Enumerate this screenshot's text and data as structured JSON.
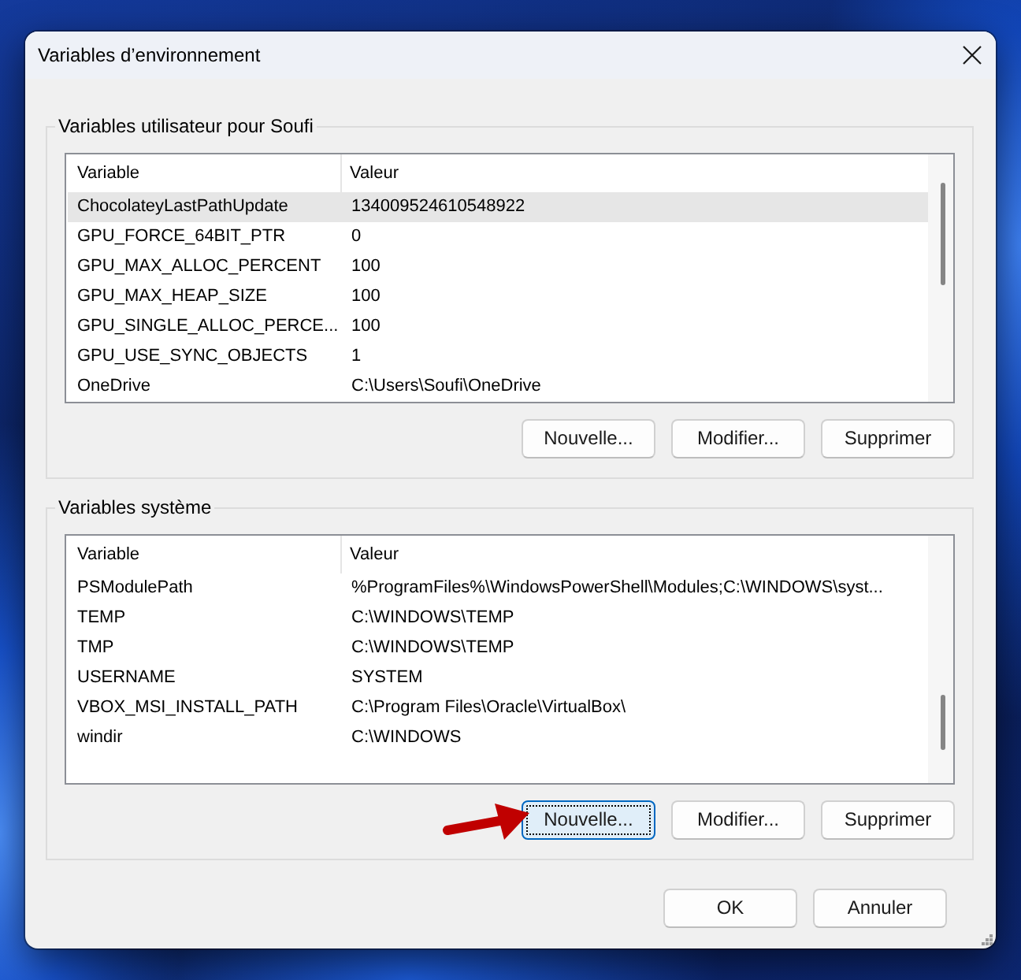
{
  "window": {
    "title": "Variables d’environnement"
  },
  "user_variables": {
    "legend": "Variables utilisateur pour Soufi",
    "columns": [
      "Variable",
      "Valeur"
    ],
    "rows": [
      {
        "variable": "ChocolateyLastPathUpdate",
        "value": "134009524610548922",
        "selected": true
      },
      {
        "variable": "GPU_FORCE_64BIT_PTR",
        "value": "0",
        "selected": false
      },
      {
        "variable": "GPU_MAX_ALLOC_PERCENT",
        "value": "100",
        "selected": false
      },
      {
        "variable": "GPU_MAX_HEAP_SIZE",
        "value": "100",
        "selected": false
      },
      {
        "variable": "GPU_SINGLE_ALLOC_PERCE...",
        "value": "100",
        "selected": false
      },
      {
        "variable": "GPU_USE_SYNC_OBJECTS",
        "value": "1",
        "selected": false
      },
      {
        "variable": "OneDrive",
        "value": "C:\\Users\\Soufi\\OneDrive",
        "selected": false
      }
    ],
    "buttons": [
      {
        "label": "Nouvelle...",
        "focused": false,
        "arrow": false
      },
      {
        "label": "Modifier...",
        "focused": false,
        "arrow": false
      },
      {
        "label": "Supprimer",
        "focused": false,
        "arrow": false
      }
    ]
  },
  "system_variables": {
    "legend": "Variables système",
    "columns": [
      "Variable",
      "Valeur"
    ],
    "rows": [
      {
        "variable": "PSModulePath",
        "value": "%ProgramFiles%\\WindowsPowerShell\\Modules;C:\\WINDOWS\\syst...",
        "selected": false
      },
      {
        "variable": "TEMP",
        "value": "C:\\WINDOWS\\TEMP",
        "selected": false
      },
      {
        "variable": "TMP",
        "value": "C:\\WINDOWS\\TEMP",
        "selected": false
      },
      {
        "variable": "USERNAME",
        "value": "SYSTEM",
        "selected": false
      },
      {
        "variable": "VBOX_MSI_INSTALL_PATH",
        "value": "C:\\Program Files\\Oracle\\VirtualBox\\",
        "selected": false
      },
      {
        "variable": "windir",
        "value": "C:\\WINDOWS",
        "selected": false
      }
    ],
    "buttons": [
      {
        "label": "Nouvelle...",
        "focused": true,
        "arrow": true
      },
      {
        "label": "Modifier...",
        "focused": false,
        "arrow": false
      },
      {
        "label": "Supprimer",
        "focused": false,
        "arrow": false
      }
    ]
  },
  "footer_buttons": [
    {
      "label": "OK"
    },
    {
      "label": "Annuler"
    }
  ]
}
